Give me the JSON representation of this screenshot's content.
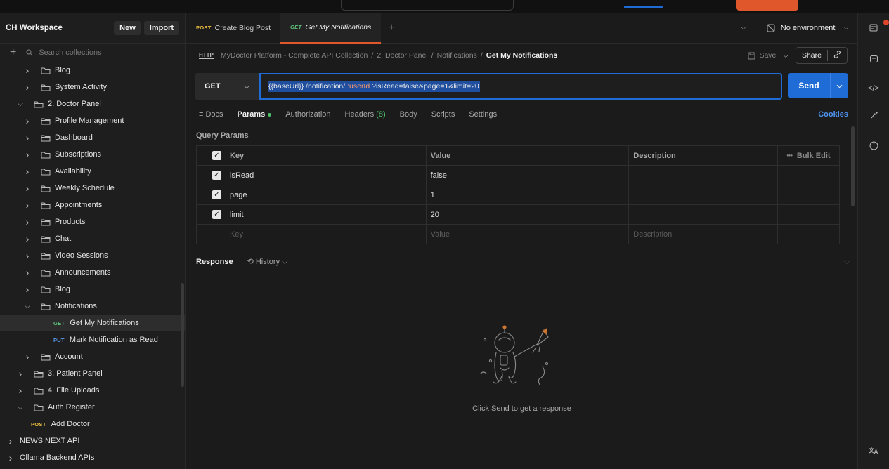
{
  "workspace": {
    "title": "CH Workspace",
    "new_label": "New",
    "import_label": "Import",
    "search_placeholder": "Search collections"
  },
  "sidebar": {
    "items": [
      {
        "type": "folder",
        "label": "Blog",
        "expanded": false,
        "level": 1
      },
      {
        "type": "folder",
        "label": "System Activity",
        "expanded": false,
        "level": 1
      },
      {
        "type": "folder",
        "label": "2. Doctor Panel",
        "expanded": true,
        "level": 0
      },
      {
        "type": "folder",
        "label": "Profile Management",
        "expanded": false,
        "level": 1
      },
      {
        "type": "folder",
        "label": "Dashboard",
        "expanded": false,
        "level": 1
      },
      {
        "type": "folder",
        "label": "Subscriptions",
        "expanded": false,
        "level": 1
      },
      {
        "type": "folder",
        "label": "Availability",
        "expanded": false,
        "level": 1
      },
      {
        "type": "folder",
        "label": "Weekly Schedule",
        "expanded": false,
        "level": 1
      },
      {
        "type": "folder",
        "label": "Appointments",
        "expanded": false,
        "level": 1
      },
      {
        "type": "folder",
        "label": "Products",
        "expanded": false,
        "level": 1
      },
      {
        "type": "folder",
        "label": "Chat",
        "expanded": false,
        "level": 1
      },
      {
        "type": "folder",
        "label": "Video Sessions",
        "expanded": false,
        "level": 1
      },
      {
        "type": "folder",
        "label": "Announcements",
        "expanded": false,
        "level": 1
      },
      {
        "type": "folder",
        "label": "Blog",
        "expanded": false,
        "level": 1
      },
      {
        "type": "folder",
        "label": "Notifications",
        "expanded": true,
        "level": 1
      },
      {
        "type": "request",
        "method": "GET",
        "label": "Get My Notifications",
        "selected": true
      },
      {
        "type": "request",
        "method": "PUT",
        "label": "Mark Notification as Read"
      },
      {
        "type": "folder",
        "label": "Account",
        "expanded": false,
        "level": 1
      },
      {
        "type": "folder",
        "label": "3. Patient Panel",
        "expanded": false,
        "level": 0
      },
      {
        "type": "folder",
        "label": "4. File Uploads",
        "expanded": false,
        "level": 0
      },
      {
        "type": "folder",
        "label": "Auth Register",
        "expanded": true,
        "level": 0
      },
      {
        "type": "request",
        "method": "POST",
        "label": "Add Doctor",
        "level": 0
      },
      {
        "type": "collection",
        "label": "NEWS NEXT API"
      },
      {
        "type": "collection",
        "label": "Ollama Backend APIs"
      }
    ]
  },
  "tabs": [
    {
      "method": "POST",
      "label": "Create Blog Post",
      "active": false
    },
    {
      "method": "GET",
      "label": "Get My Notifications",
      "active": true
    }
  ],
  "environment": {
    "label": "No environment"
  },
  "breadcrumb": {
    "http_icon": "HTTP",
    "parts": [
      "MyDoctor Platform - Complete API Collection",
      "2. Doctor Panel",
      "Notifications"
    ],
    "current": "Get My Notifications",
    "separator": "/"
  },
  "actions": {
    "save_label": "Save",
    "share_label": "Share"
  },
  "request": {
    "method": "GET",
    "url_base": "{{baseUrl}}",
    "url_path": " /notification/ ",
    "url_var": ":userId",
    "url_query": " ?isRead=false&page=1&limit=20",
    "send_label": "Send"
  },
  "request_tabs": {
    "docs": "Docs",
    "params": "Params",
    "authorization": "Authorization",
    "headers": "Headers",
    "headers_count": "(8)",
    "body": "Body",
    "scripts": "Scripts",
    "settings": "Settings",
    "cookies": "Cookies"
  },
  "query_params": {
    "label": "Query Params",
    "headers": [
      "Key",
      "Value",
      "Description"
    ],
    "bulk_edit": "Bulk Edit",
    "bulk_icon": "•••",
    "rows": [
      {
        "key": "isRead",
        "value": "false",
        "description": "",
        "checked": true
      },
      {
        "key": "page",
        "value": "1",
        "description": "",
        "checked": true
      },
      {
        "key": "limit",
        "value": "20",
        "description": "",
        "checked": true
      }
    ],
    "placeholder": {
      "key": "Key",
      "value": "Value",
      "description": "Description"
    }
  },
  "response": {
    "title": "Response",
    "history_label": "History",
    "empty_message": "Click Send to get a response"
  },
  "colors": {
    "accent": "#1f6cd6",
    "tab_underline": "#e0572b",
    "get": "#5ec47a",
    "put": "#5b9bef",
    "post": "#f0c040"
  }
}
